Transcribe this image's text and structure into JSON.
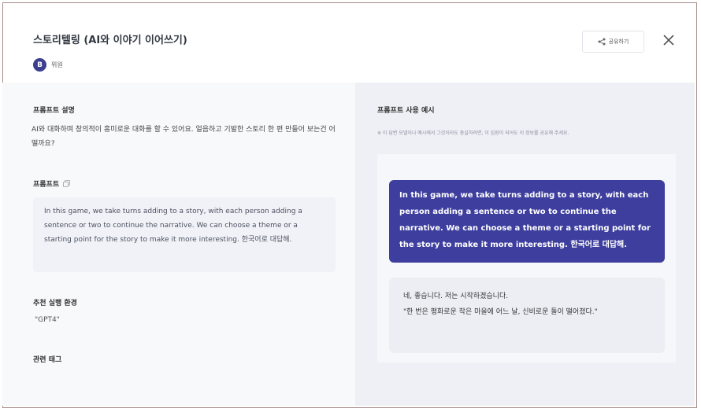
{
  "header": {
    "title": "스토리텔링 (AI와 이야기 이어쓰기)",
    "author_initial": "B",
    "author_name": "위원",
    "share_label": "공유하기"
  },
  "left": {
    "description_label": "프롬프트 설명",
    "description_text": "AI와 대화하며 창의적이 흥미로운 대화를 할 수 있어요. 얼음하고 기발한 스토리 한 편 만들어 보는건 어떨까요?",
    "prompt_label": "프롬프트",
    "prompt_text": "In this game, we take turns adding to a story, with each person adding a sentence or two to continue the narrative. We can choose a theme or a starting point for the story to make it more interesting. 한국어로 대답해.",
    "env_label": "추천 실행 환경",
    "env_value": "\"GPT4\"",
    "tags_label": "관련 태그"
  },
  "right": {
    "title": "프롬프트 사용 예시",
    "note": "※ 이 답변 모델이나 예시에서 그것이라도 충실하려면, 이 입장이 되어도 이 정보를 공유해 주세요.",
    "user_message": "In this game, we take turns adding to a story, with each person adding a sentence or two to continue the narrative. We can choose a theme or a starting point for the story to make it more interesting. 한국어로 대답해.",
    "ai_message_line1": "네, 좋습니다. 저는 시작하겠습니다.",
    "ai_message_line2": "\"한 번은 평화로운 작은 마을에 어느 날, 신비로운 돌이 떨어졌다.\""
  },
  "colors": {
    "accent": "#3d3e9e",
    "frame_border": "#a48a86",
    "left_panel_bg": "#f8f9fb",
    "right_panel_bg": "#eef0f5"
  },
  "icons": {
    "share": "share-icon",
    "close": "close-icon",
    "copy": "copy-icon"
  }
}
